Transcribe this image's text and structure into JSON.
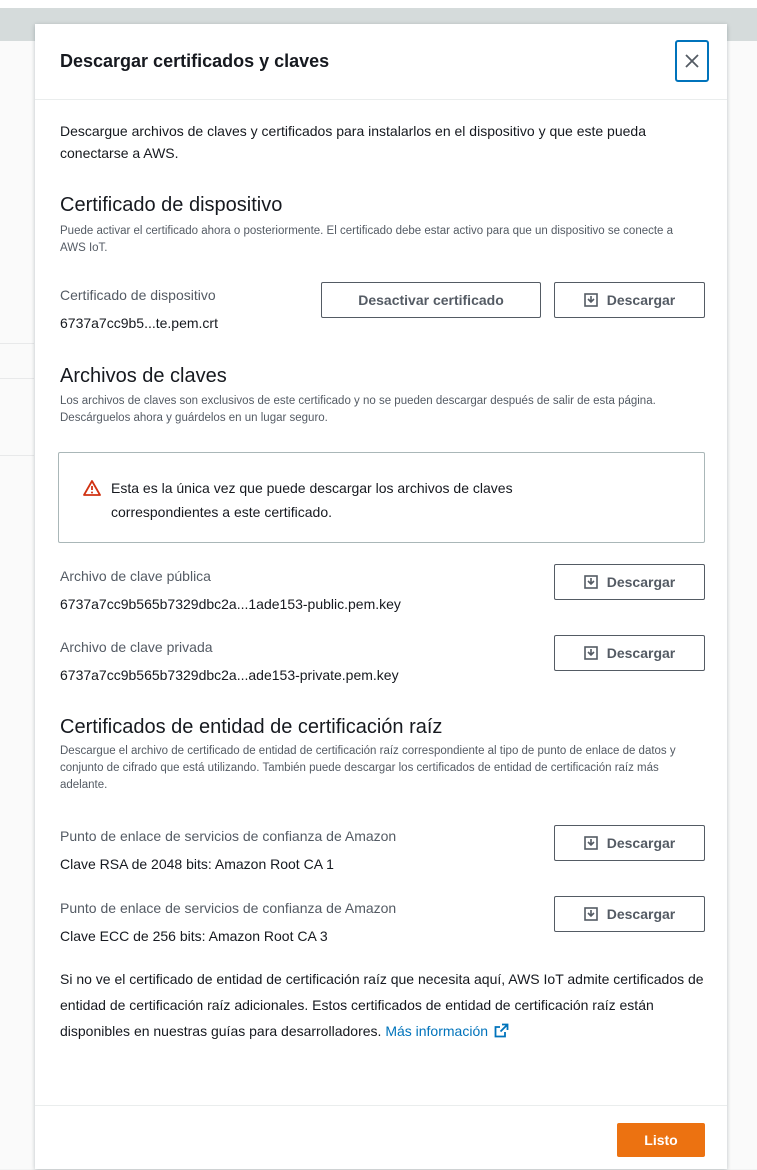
{
  "modal": {
    "title": "Descargar certificados y claves",
    "intro": "Descargue archivos de claves y certificados para instalarlos en el dispositivo y que este pueda conectarse a AWS."
  },
  "device_certificate": {
    "heading": "Certificado de dispositivo",
    "description": "Puede activar el certificado ahora o posteriormente. El certificado debe estar activo para que un dispositivo se conecte a AWS IoT.",
    "label": "Certificado de dispositivo",
    "filename": "6737a7cc9b5...te.pem.crt",
    "deactivate_label": "Desactivar certificado",
    "download_label": "Descargar"
  },
  "key_files": {
    "heading": "Archivos de claves",
    "description": "Los archivos de claves son exclusivos de este certificado y no se pueden descargar después de salir de esta página. Descárguelos ahora y guárdelos en un lugar seguro.",
    "alert": "Esta es la única vez que puede descargar los archivos de claves correspondientes a este certificado.",
    "public_label": "Archivo de clave pública",
    "public_filename": "6737a7cc9b565b7329dbc2a...1ade153-public.pem.key",
    "private_label": "Archivo de clave privada",
    "private_filename": "6737a7cc9b565b7329dbc2a...ade153-private.pem.key",
    "download_label": "Descargar"
  },
  "root_ca": {
    "heading": "Certificados de entidad de certificación raíz",
    "description": "Descargue el archivo de certificado de entidad de certificación raíz correspondiente al tipo de punto de enlace de datos y conjunto de cifrado que está utilizando. También puede descargar los certificados de entidad de certificación raíz más adelante.",
    "rsa_label": "Punto de enlace de servicios de confianza de Amazon",
    "rsa_value": "Clave RSA de 2048 bits: Amazon Root CA 1",
    "ecc_label": "Punto de enlace de servicios de confianza de Amazon",
    "ecc_value": "Clave ECC de 256 bits: Amazon Root CA 3",
    "download_label": "Descargar",
    "note": "Si no ve el certificado de entidad de certificación raíz que necesita aquí, AWS IoT admite certificados de entidad de certificación raíz adicionales. Estos certificados de entidad de certificación raíz están disponibles en nuestras guías para desarrolladores.",
    "more_info": "Más información"
  },
  "footer": {
    "done_label": "Listo"
  },
  "colors": {
    "primary": "#ec7211",
    "link": "#0073bb",
    "warning": "#d13212"
  },
  "icons": [
    "close-icon",
    "download-icon",
    "warning-icon",
    "external-link-icon"
  ]
}
